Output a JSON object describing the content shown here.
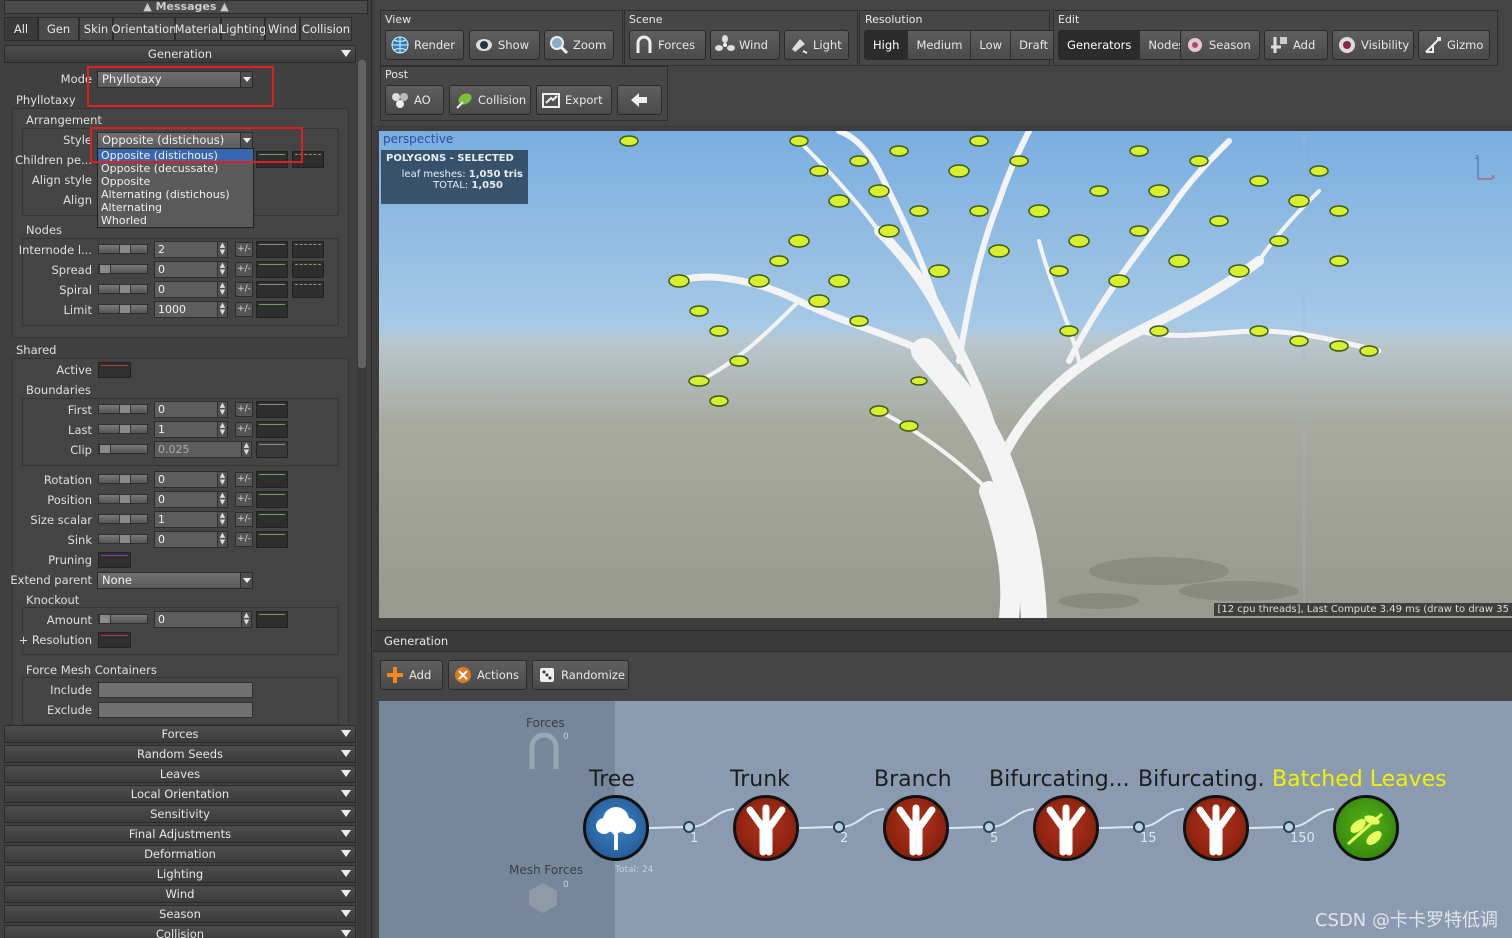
{
  "messages": {
    "label": "Messages"
  },
  "tabs": [
    "All",
    "Gen",
    "Skin",
    "Orientation",
    "Material",
    "Lighting",
    "Wind",
    "Collision"
  ],
  "generation_section": {
    "title": "Generation"
  },
  "mode": {
    "label": "Mode",
    "value": "Phyllotaxy"
  },
  "phyllotaxy": {
    "title": "Phyllotaxy",
    "arrangement": {
      "title": "Arrangement",
      "style_label": "Style",
      "style_value": "Opposite (distichous)",
      "children_label": "Children pe...",
      "align_style_label": "Align style",
      "align_label": "Align",
      "options": [
        "Opposite (distichous)",
        "Opposite (decussate)",
        "Opposite",
        "Alternating (distichous)",
        "Alternating",
        "Whorled"
      ]
    },
    "nodes": {
      "title": "Nodes",
      "rows": [
        {
          "label": "Internode l...",
          "value": "2"
        },
        {
          "label": "Spread",
          "value": "0"
        },
        {
          "label": "Spiral",
          "value": "0"
        },
        {
          "label": "Limit",
          "value": "1000"
        }
      ]
    }
  },
  "shared": {
    "title": "Shared",
    "active_label": "Active",
    "boundaries": {
      "title": "Boundaries",
      "rows": [
        {
          "label": "First",
          "value": "0"
        },
        {
          "label": "Last",
          "value": "1"
        },
        {
          "label": "Clip",
          "value": "0.025"
        }
      ]
    },
    "transform_rows": [
      {
        "label": "Rotation",
        "value": "0"
      },
      {
        "label": "Position",
        "value": "0"
      },
      {
        "label": "Size scalar",
        "value": "1"
      },
      {
        "label": "Sink",
        "value": "0"
      }
    ],
    "pruning_label": "Pruning",
    "extend_parent_label": "Extend parent",
    "extend_parent_value": "None",
    "knockout": {
      "title": "Knockout",
      "amount_label": "Amount",
      "amount_value": "0",
      "resolution_label": "+ Resolution"
    },
    "force_mesh": {
      "title": "Force Mesh Containers",
      "include_label": "Include",
      "exclude_label": "Exclude"
    },
    "plusminus": "+/-"
  },
  "collapsed_sections": [
    "Forces",
    "Random Seeds",
    "Leaves",
    "Local Orientation",
    "Sensitivity",
    "Final Adjustments",
    "Deformation",
    "Lighting",
    "Wind",
    "Season",
    "Collision"
  ],
  "toolbar": {
    "view": {
      "title": "View",
      "buttons": [
        "Render",
        "Show",
        "Zoom"
      ]
    },
    "scene": {
      "title": "Scene",
      "buttons": [
        "Forces",
        "Wind",
        "Light"
      ]
    },
    "resolution": {
      "title": "Resolution",
      "options": [
        "High",
        "Medium",
        "Low",
        "Draft"
      ],
      "selected": "High"
    },
    "edit": {
      "title": "Edit",
      "options": [
        "Generators",
        "Nodes"
      ],
      "selected": "Generators",
      "buttons": [
        "Season",
        "Add",
        "Visibility",
        "Gizmo"
      ]
    },
    "post": {
      "title": "Post",
      "buttons": [
        "AO",
        "Collision",
        "Export"
      ]
    }
  },
  "viewport": {
    "label": "perspective",
    "stats_title": "POLYGONS - SELECTED",
    "leaf_label": "leaf meshes:",
    "leaf_value": "1,050 tris",
    "total_label": "TOTAL:",
    "total_value": "1,050",
    "status": "[12 cpu threads], Last Compute 3.49 ms (draw to draw 35",
    "axis_z": "z",
    "axis_x": "x"
  },
  "generation_panel": {
    "title": "Generation",
    "buttons": [
      "Add",
      "Actions",
      "Randomize"
    ],
    "forces_label": "Forces",
    "forces_count": "0",
    "mesh_forces_label": "Mesh Forces",
    "mesh_forces_count": "0",
    "total": "Total: 24",
    "nodes": [
      {
        "name": "Tree",
        "type": "tree",
        "port": "1"
      },
      {
        "name": "Trunk",
        "type": "branch",
        "port": "2"
      },
      {
        "name": "Branch",
        "type": "branch",
        "port": "5"
      },
      {
        "name": "Bifurcating...",
        "type": "branch",
        "port": "15"
      },
      {
        "name": "Bifurcating.",
        "type": "branch",
        "port": "150"
      },
      {
        "name": "Batched Leaves",
        "type": "leaf",
        "port": ""
      }
    ]
  },
  "watermark": "CSDN @卡卡罗特低调",
  "colors": {
    "selection_highlight": "#e0201f",
    "dropdown_selected": "#3767b0",
    "leaf_caption": "#f2f200"
  }
}
